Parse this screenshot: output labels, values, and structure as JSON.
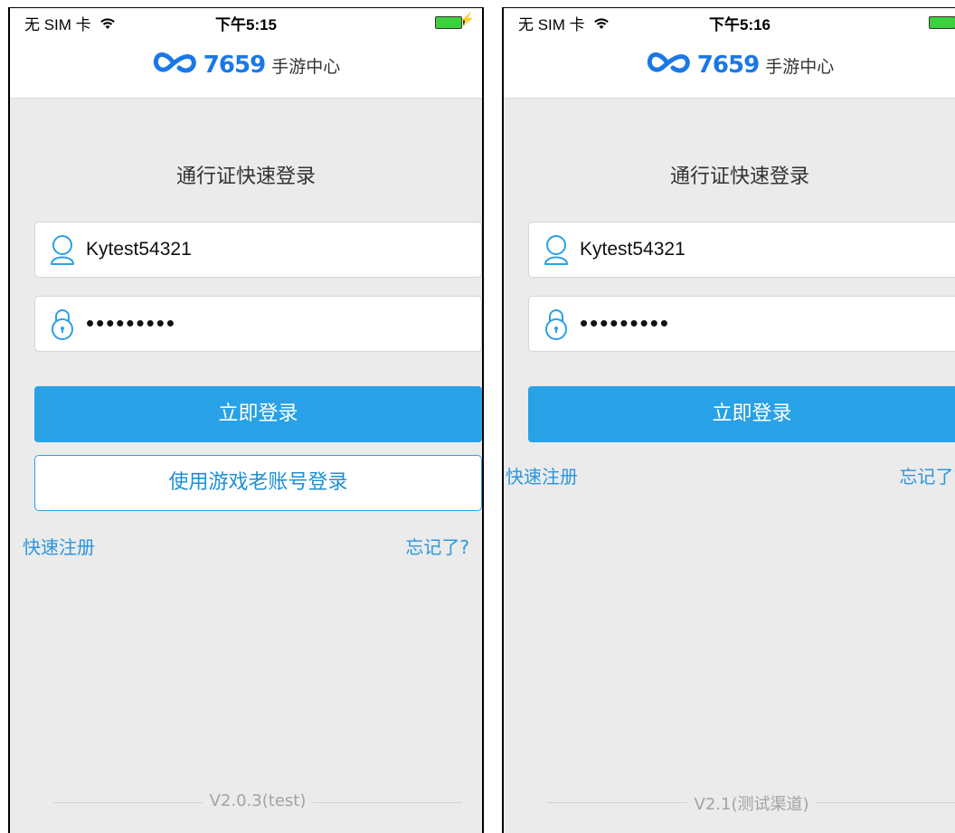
{
  "screens": [
    {
      "status": {
        "carrier": "无 SIM 卡",
        "time": "下午5:15"
      },
      "brand": {
        "number": "7659",
        "name": "手游中心"
      },
      "login_title": "通行证快速登录",
      "username": {
        "value": "Kytest54321"
      },
      "password": {
        "value": "•••••••••"
      },
      "login_button": "立即登录",
      "legacy_login_button": "使用游戏老账号登录",
      "register_link": "快速注册",
      "forgot_link": "忘记了?",
      "version": "V2.0.3(test)"
    },
    {
      "status": {
        "carrier": "无 SIM 卡",
        "time": "下午5:16"
      },
      "brand": {
        "number": "7659",
        "name": "手游中心"
      },
      "login_title": "通行证快速登录",
      "username": {
        "value": "Kytest54321"
      },
      "password": {
        "value": "•••••••••"
      },
      "login_button": "立即登录",
      "register_link": "快速注册",
      "forgot_link": "忘记了?",
      "version": "V2.1(测试渠道)"
    }
  ],
  "colors": {
    "accent": "#29a1e6",
    "link": "#2b96df",
    "background": "#ebebeb",
    "battery": "#3cd13c"
  },
  "icons": [
    "wifi-icon",
    "battery-icon",
    "charging-bolt-icon",
    "brand-logo-icon",
    "user-icon",
    "lock-icon"
  ]
}
